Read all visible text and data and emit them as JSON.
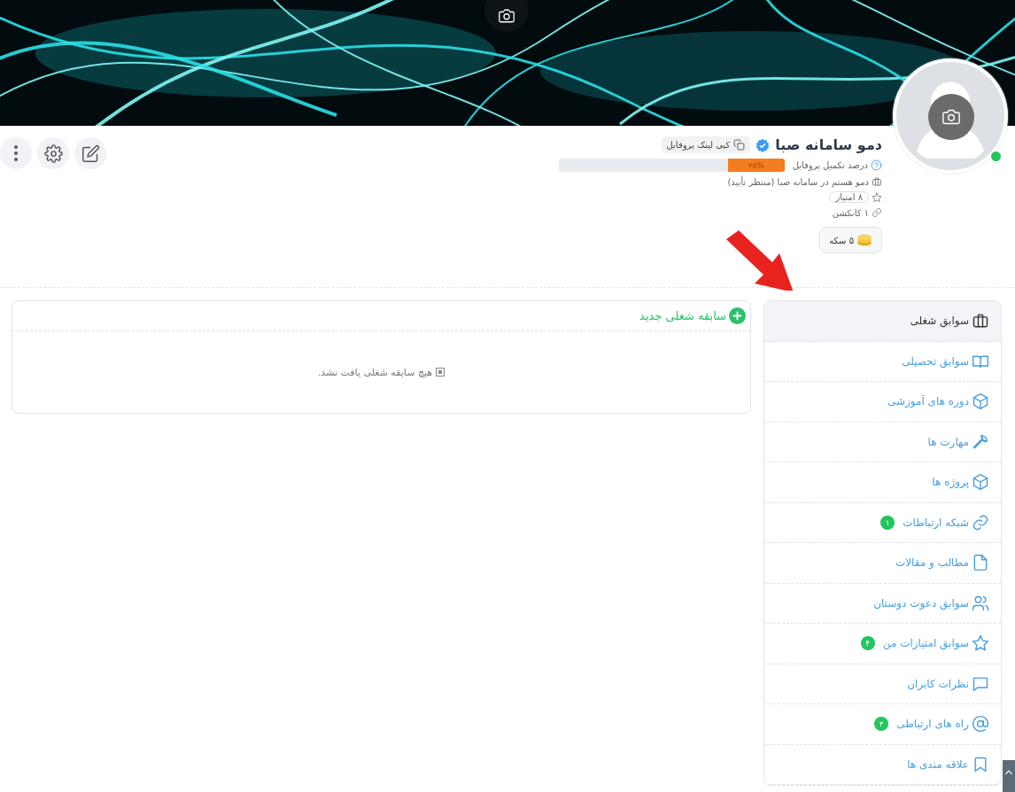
{
  "profile": {
    "name": "دمو سامانه صبا",
    "verified": true,
    "online": true,
    "copy_link": "کپی لینک پروفایل",
    "completion": {
      "label": "درصد تکمیل پروفایل",
      "level": 0.25,
      "reading": "۲۵%"
    },
    "job": "دمو هستم در سامانه صبا (منتظر تأیید)",
    "points": "۸ امتیاز",
    "connections": "۱ کانکشن",
    "coins": "۵ سکه"
  },
  "sidebar": {
    "items": [
      {
        "label": "سوابق شغلی",
        "selected": true
      },
      {
        "label": "سوابق تحصیلی",
        "selected": false
      },
      {
        "label": "دوره های آموزشی",
        "selected": false
      },
      {
        "label": "مهارت ها",
        "selected": false
      },
      {
        "label": "پروژه ها",
        "selected": false
      },
      {
        "label": "شبکه ارتباطات",
        "selected": false,
        "badge": "۱"
      },
      {
        "label": "مطالب و مقالات",
        "selected": false
      },
      {
        "label": "سوابق دعوت دوستان",
        "selected": false
      },
      {
        "label": "سوابق امتیازات من",
        "selected": false,
        "badge": "۴"
      },
      {
        "label": "نظرات کابران",
        "selected": false
      },
      {
        "label": "راه های ارتباطی",
        "selected": false,
        "badge": "۲"
      },
      {
        "label": "علاقه مندی ها",
        "selected": false
      }
    ]
  },
  "panel": {
    "add_button": "سابقه شغلی جدید",
    "empty_message": "هیچ سابقه شغلی یافت نشد."
  }
}
